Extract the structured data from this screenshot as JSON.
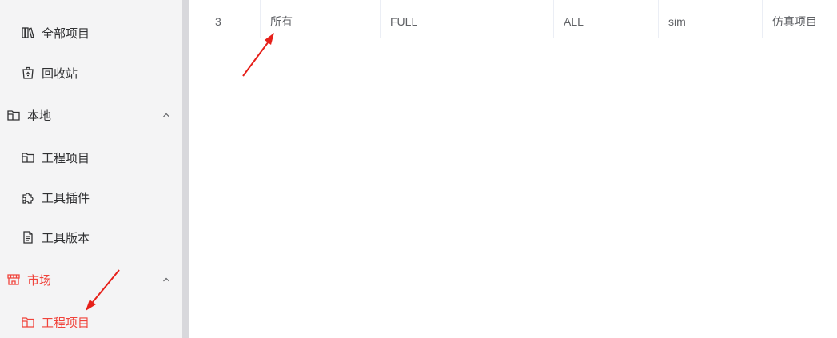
{
  "sidebar": {
    "all_projects": "全部项目",
    "recycle_bin": "回收站",
    "local_group": "本地",
    "local_items": [
      "工程项目",
      "工具插件",
      "工具版本"
    ],
    "market_group": "市场",
    "market_items": [
      "工程项目"
    ],
    "accent_color": "#f0433b",
    "icons": {
      "all_projects": "books-icon",
      "recycle_bin": "trash-bin-icon",
      "local_group": "folder-icon",
      "local_items": [
        "folder-icon",
        "puzzle-icon",
        "document-icon"
      ],
      "market_group": "shop-icon",
      "market_items": [
        "folder-icon"
      ]
    }
  },
  "table": {
    "rows": [
      [
        "3",
        "所有",
        "FULL",
        "ALL",
        "sim",
        "仿真项目"
      ]
    ]
  },
  "annotations": {
    "arrow_color": "#e6201a"
  }
}
